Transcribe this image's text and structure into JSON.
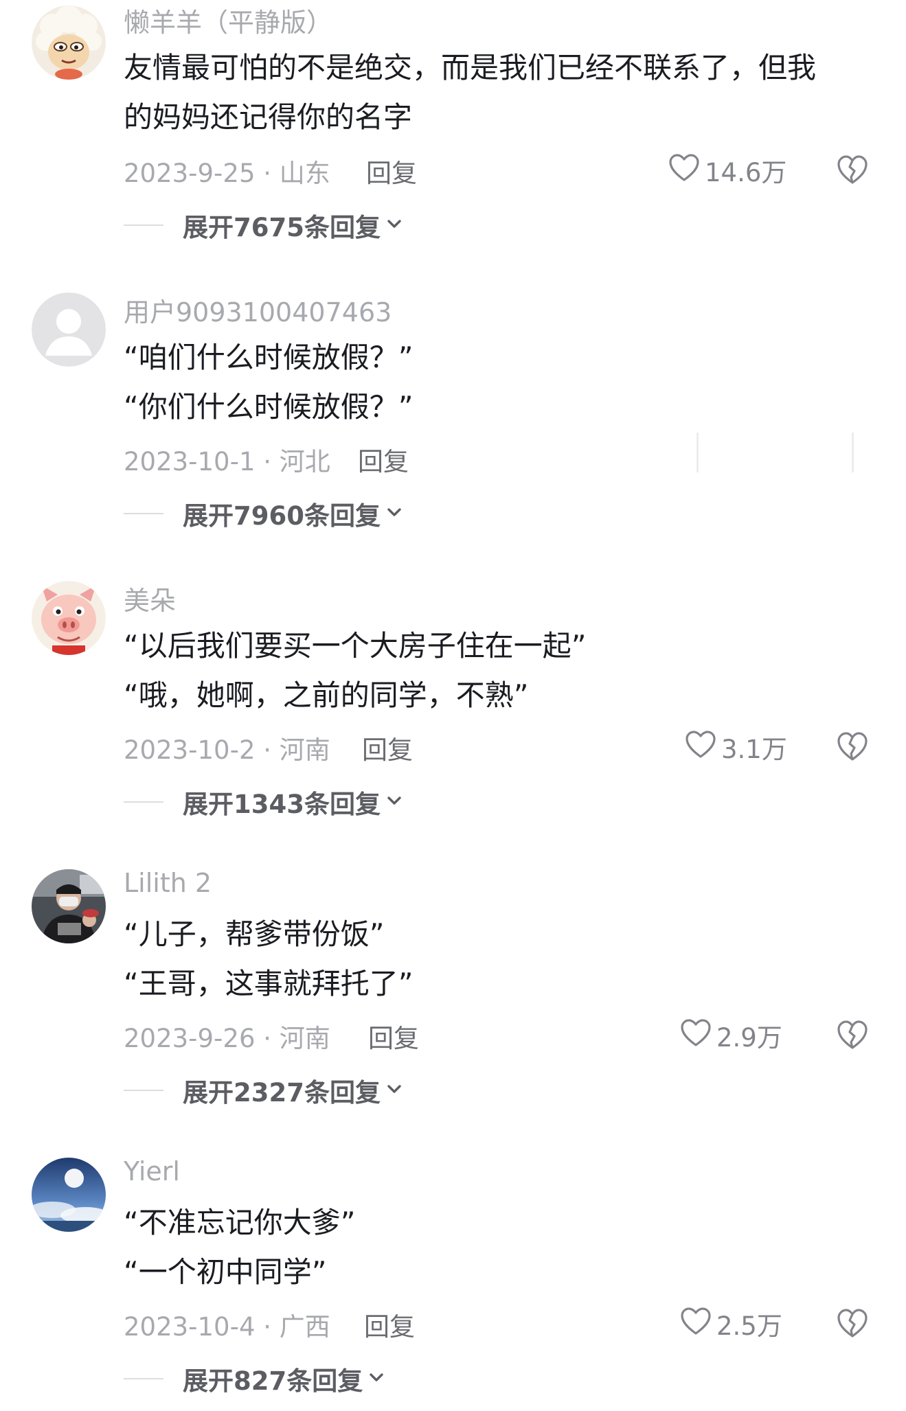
{
  "comments": [
    {
      "username": "懒羊羊（平静版）",
      "lines": [
        "友情最可怕的不是绝交，而是我们已经不联系了，但我",
        "的妈妈还记得你的名字"
      ],
      "meta": "2023-9-25 · 山东",
      "reply_label": "回复",
      "likes": "14.6万",
      "expand_label": "展开7675条回复",
      "avatar_icon": "lazy-goat-avatar"
    },
    {
      "username": "用户9093100407463",
      "lines": [
        "“咱们什么时候放假？”",
        "“你们什么时候放假？”"
      ],
      "meta": "2023-10-1 · 河北",
      "reply_label": "回复",
      "likes": "",
      "expand_label": "展开7960条回复",
      "avatar_icon": "default-user-avatar"
    },
    {
      "username": "美朵",
      "lines": [
        "“以后我们要买一个大房子住在一起”",
        "“哦，她啊，之前的同学，不熟”"
      ],
      "meta": "2023-10-2 · 河南",
      "reply_label": "回复",
      "likes": "3.1万",
      "expand_label": "展开1343条回复",
      "avatar_icon": "cartoon-pig-avatar"
    },
    {
      "username": "Lilith 2",
      "lines": [
        "“儿子，帮爹带份饭”",
        "“王哥，这事就拜托了”"
      ],
      "meta": "2023-9-26 · 河南",
      "reply_label": "回复",
      "likes": "2.9万",
      "expand_label": "展开2327条回复",
      "avatar_icon": "photo-person-avatar"
    },
    {
      "username": "Yierl",
      "lines": [
        "“不准忘记你大爹”",
        "“一个初中同学”"
      ],
      "meta": "2023-10-4 · 广西",
      "reply_label": "回复",
      "likes": "2.5万",
      "expand_label": "展开827条回复",
      "avatar_icon": "moon-sky-avatar"
    }
  ],
  "colors": {
    "username": "#a8a9ae",
    "body_text": "#1b1c22",
    "meta": "#a8a9ae",
    "expand_text": "#5c5d63",
    "icon_stroke": "#83848a"
  }
}
